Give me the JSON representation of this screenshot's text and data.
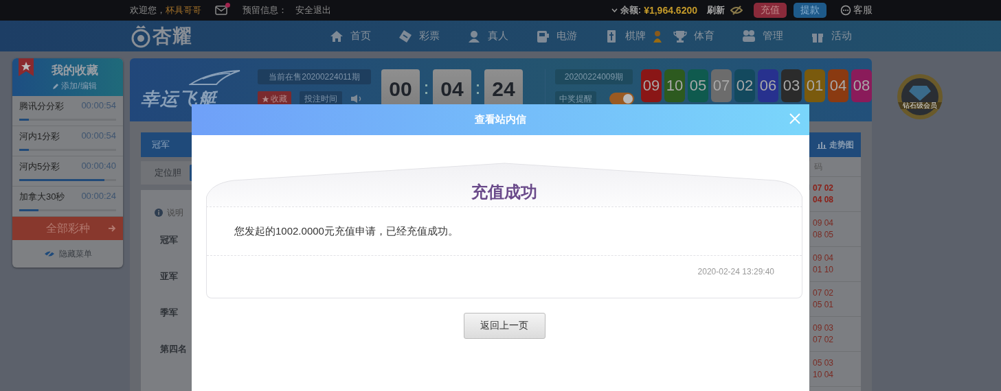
{
  "top_bar": {
    "welcome": "欢迎您，",
    "username": "杯具哥哥",
    "mail_unread": true,
    "reserved_info_label": "预留信息：",
    "logout": "安全退出",
    "balance_label": "余额:",
    "balance": "¥1,964.6200",
    "refresh": "刷新",
    "deposit": "充值",
    "withdraw": "提款",
    "support": "客服"
  },
  "nav": {
    "logo": "杏耀",
    "items": [
      {
        "label": "首页",
        "kind": "home"
      },
      {
        "label": "彩票",
        "kind": "ticket"
      },
      {
        "label": "真人",
        "kind": "person"
      },
      {
        "label": "电游",
        "kind": "slot"
      },
      {
        "label": "棋牌",
        "kind": "cards"
      },
      {
        "label": "体育",
        "kind": "trophy"
      },
      {
        "label": "管理",
        "kind": "users"
      },
      {
        "label": "活动",
        "kind": "gift"
      }
    ]
  },
  "favorites": {
    "title": "我的收藏",
    "edit": "添加/编辑",
    "items": [
      {
        "name": "腾讯分分彩",
        "time": "00:00:54",
        "level": 0.1
      },
      {
        "name": "河内1分彩",
        "time": "00:00:54",
        "level": 0.1
      },
      {
        "name": "河内5分彩",
        "time": "00:00:40",
        "level": 0.88
      },
      {
        "name": "加拿大30秒",
        "time": "00:00:24",
        "level": 0.2
      }
    ],
    "all_button": "全部彩种",
    "hide_menu": "隐藏菜单"
  },
  "game": {
    "logo": "幸运飞艇",
    "current_period": "当前在售20200224011期",
    "favorite": "收藏",
    "bet_time": "投注时间",
    "countdown": [
      "00",
      "04",
      "24"
    ],
    "last_period": "20200224009期",
    "win_alert": "中奖提醒",
    "win_alert_on": true,
    "balls": [
      {
        "number": "09",
        "color": "#8a1616"
      },
      {
        "number": "10",
        "color": "#2d5a1f"
      },
      {
        "number": "05",
        "color": "#0f5a4e"
      },
      {
        "number": "07",
        "color": "#6c6c6c"
      },
      {
        "number": "02",
        "color": "#13495e"
      },
      {
        "number": "06",
        "color": "#27318e"
      },
      {
        "number": "03",
        "color": "#2b2b2b"
      },
      {
        "number": "01",
        "color": "#7a5a0d"
      },
      {
        "number": "04",
        "color": "#8a3a11"
      },
      {
        "number": "08",
        "color": "#8a1b5a"
      }
    ]
  },
  "bet_panel": {
    "tabs": [
      {
        "label": "冠军",
        "selected": true
      }
    ],
    "chart_button": "走势图",
    "play_label": "定位胆",
    "info": "说明",
    "positions": [
      "冠军",
      "亚军",
      "季军",
      "第四名"
    ]
  },
  "history": {
    "header": "码",
    "rows": [
      {
        "lines": [
          "07 02",
          "04 08"
        ],
        "highlighted": true
      },
      {
        "lines": [
          "09 04",
          "08 05"
        ],
        "highlighted": false
      },
      {
        "lines": [
          "09 04",
          "01 10"
        ],
        "highlighted": false
      },
      {
        "lines": [
          "07 02",
          "05 01"
        ],
        "highlighted": false
      },
      {
        "lines": [
          "09 03",
          "07 02"
        ],
        "highlighted": false
      },
      {
        "lines": [
          "05 03",
          "10 04"
        ],
        "highlighted": false
      }
    ]
  },
  "vip_badge": {
    "label": "钻石级会员"
  },
  "dialog": {
    "title": "查看站内信",
    "message_title": "充值成功",
    "message": "您发起的1002.0000元充值申请，已经充值成功。",
    "date": "2020-02-24 13:29:40",
    "back_button": "返回上一页"
  }
}
